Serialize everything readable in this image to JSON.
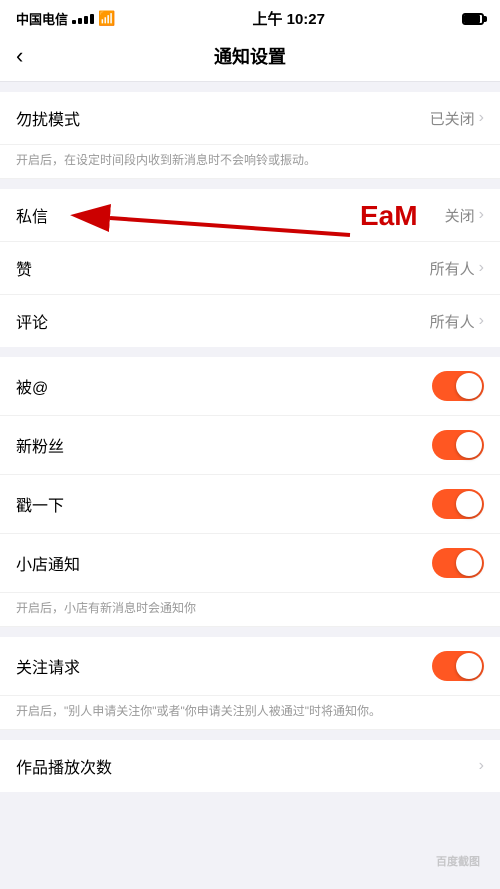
{
  "statusBar": {
    "carrier": "中国电信",
    "time": "上午 10:27"
  },
  "navBar": {
    "backLabel": "‹",
    "title": "通知设置"
  },
  "sections": [
    {
      "id": "do-not-disturb",
      "items": [
        {
          "label": "勿扰模式",
          "value": "已关闭",
          "type": "link"
        }
      ],
      "hint": "开启后，在设定时间段内收到新消息时不会响铃或振动。"
    },
    {
      "id": "privacy",
      "items": [
        {
          "label": "私信",
          "value": "关闭",
          "type": "link"
        },
        {
          "label": "赞",
          "value": "所有人",
          "type": "link"
        },
        {
          "label": "评论",
          "value": "所有人",
          "type": "link"
        }
      ]
    },
    {
      "id": "toggles",
      "items": [
        {
          "label": "被@",
          "type": "toggle",
          "enabled": true
        },
        {
          "label": "新粉丝",
          "type": "toggle",
          "enabled": true
        },
        {
          "label": "戳一下",
          "type": "toggle",
          "enabled": true
        },
        {
          "label": "小店通知",
          "type": "toggle",
          "enabled": true,
          "hint": "开启后，小店有新消息时会通知你"
        }
      ]
    },
    {
      "id": "follow",
      "items": [
        {
          "label": "关注请求",
          "type": "toggle",
          "enabled": true,
          "hint": "开启后，\"别人申请关注你\"或者\"你申请关注别人被通过\"时将通知你。"
        }
      ]
    },
    {
      "id": "play",
      "items": [
        {
          "label": "作品播放次数",
          "type": "link-no-value"
        }
      ]
    }
  ],
  "watermark": "百度截图",
  "arrowAnnotation": {
    "label": "EaM"
  }
}
